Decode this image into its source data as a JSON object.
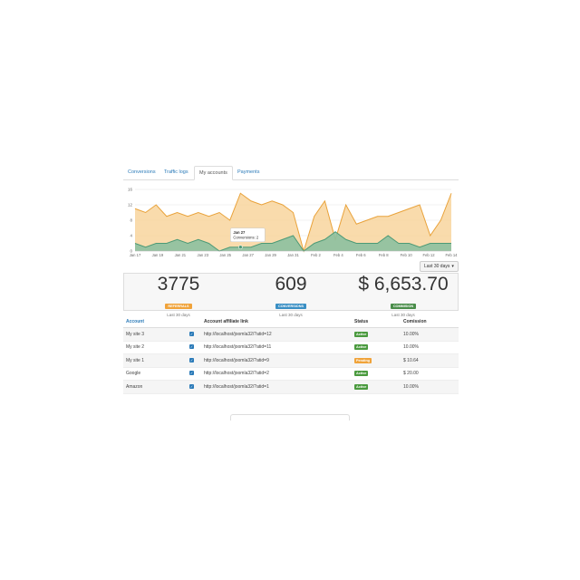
{
  "colors": {
    "accent": "#2a7ab8",
    "referrals": "#f0a33a",
    "conversions": "#3a8fc4",
    "commission": "#4a8d4a",
    "active": "#4a9a3e",
    "pending": "#f0a33a",
    "area_top": "#f7cf90",
    "line_top": "#e9a23a",
    "area_bottom": "#8cc0a0",
    "line_bottom": "#4d9a76"
  },
  "tabs": [
    "Conversions",
    "Traffic logs",
    "My accounts",
    "Payments"
  ],
  "active_tab": 2,
  "range_button": {
    "label": "Last 30 days",
    "icon": "caret-down-icon"
  },
  "tooltip": {
    "date": "Jan 27",
    "text": "Conversions: 2"
  },
  "chart_data": {
    "type": "area",
    "y_ticks": [
      0,
      4,
      8,
      12,
      16
    ],
    "ylim": [
      0,
      16
    ],
    "x_labels": [
      "Jan 17",
      "Jan 19",
      "Jan 21",
      "Jan 23",
      "Jan 25",
      "Jan 27",
      "Jan 29",
      "Jan 31",
      "Feb 2",
      "Feb 4",
      "Feb 6",
      "Feb 8",
      "Feb 10",
      "Feb 12",
      "Feb 14"
    ],
    "grid": true,
    "series": [
      {
        "values": [
          11,
          10,
          12,
          9,
          10,
          9,
          10,
          9,
          10,
          8,
          15,
          13,
          12,
          13,
          12,
          10,
          0,
          9,
          13,
          3,
          12,
          7,
          8,
          9,
          9,
          10,
          11,
          12,
          4,
          8,
          15
        ]
      },
      {
        "values": [
          2,
          1,
          2,
          2,
          3,
          2,
          3,
          2,
          0,
          1,
          1,
          1,
          2,
          2,
          3,
          4,
          0,
          2,
          3,
          5,
          3,
          2,
          2,
          2,
          4,
          2,
          2,
          1,
          2,
          2,
          2
        ]
      }
    ]
  },
  "stats": [
    {
      "value": "3775",
      "badge": "REFERRALS",
      "sub": "Last 30 days"
    },
    {
      "value": "609",
      "badge": "CONVERSIONS",
      "sub": "Last 30 days"
    },
    {
      "value": "$ 6,653.70",
      "badge": "COMMISION",
      "sub": "Last 30 days"
    }
  ],
  "table": {
    "headers": [
      "Account",
      "Account affiliate link",
      "Status",
      "Comission"
    ],
    "rows": [
      {
        "account": "My site 3",
        "link": "http://localhost/joomla32/?atid=12",
        "status": "Active",
        "commission": "10.00%"
      },
      {
        "account": "My site 2",
        "link": "http://localhost/joomla32/?atid=11",
        "status": "Active",
        "commission": "10.00%"
      },
      {
        "account": "My site 1",
        "link": "http://localhost/joomla32/?atid=9",
        "status": "Pending",
        "commission": "$ 10.64"
      },
      {
        "account": "Google",
        "link": "http://localhost/joomla32/?atid=2",
        "status": "Active",
        "commission": "$ 20.00"
      },
      {
        "account": "Amazon",
        "link": "http://localhost/joomla32/?atid=1",
        "status": "Active",
        "commission": "10.00%"
      }
    ]
  }
}
